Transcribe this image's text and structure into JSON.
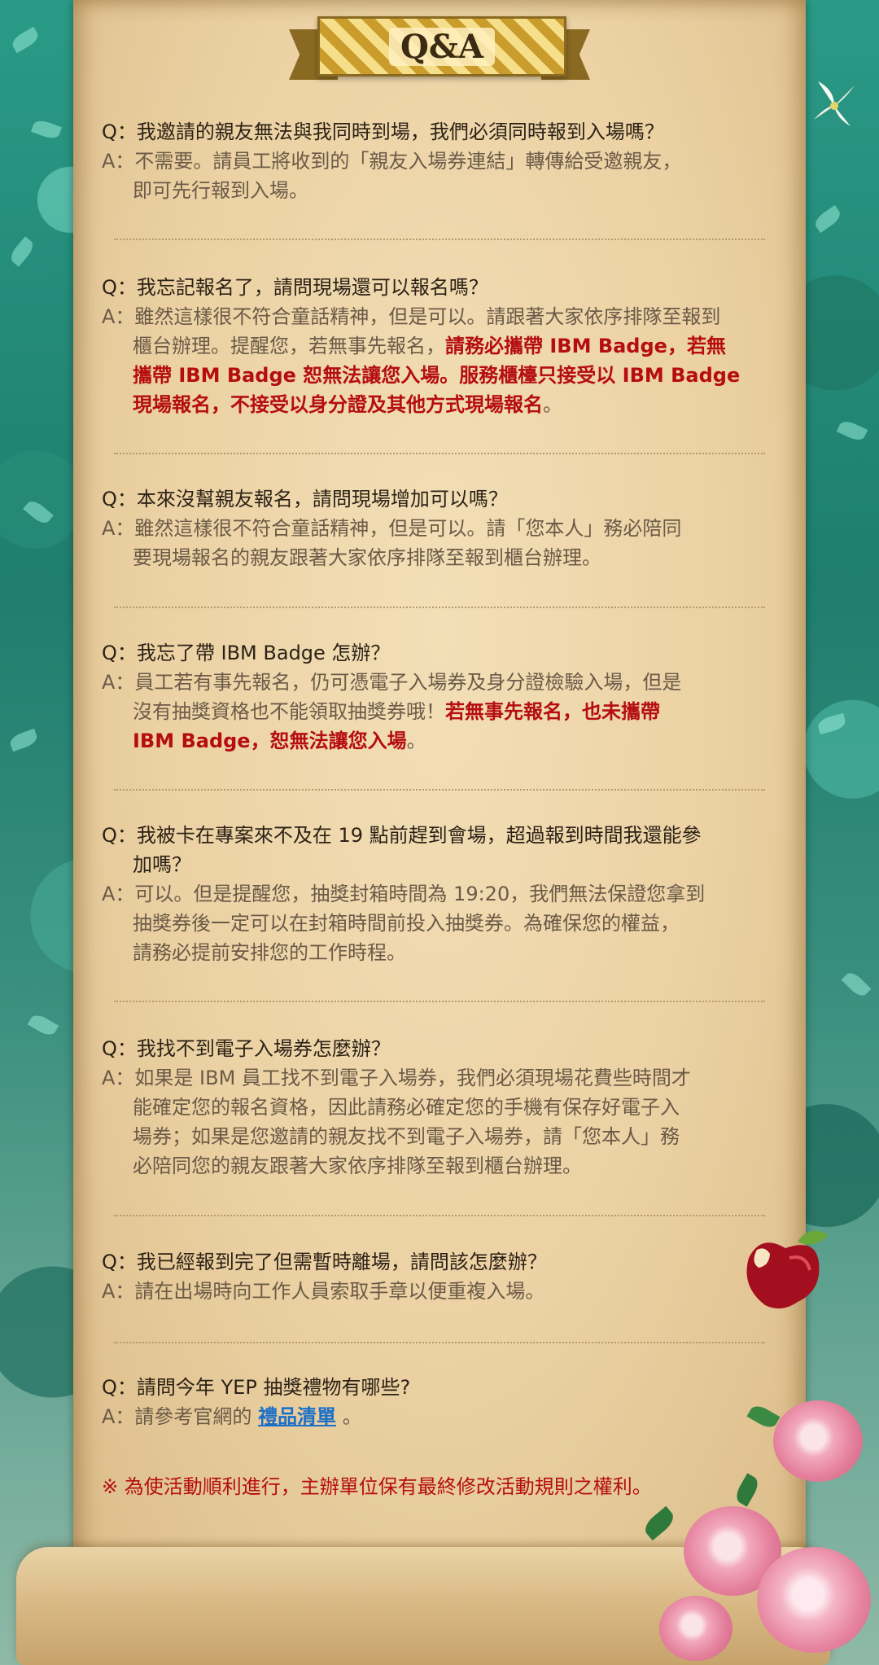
{
  "header": {
    "title": "Q&A"
  },
  "colors": {
    "highlight": "#b50d10",
    "link": "#1a6fc8",
    "question": "#2c2116",
    "answer": "#6b5a47"
  },
  "labels": {
    "q": "Q：",
    "a": "A："
  },
  "faq": [
    {
      "q": "我邀請的親友無法與我同時到場，我們必須同時報到入場嗎？",
      "a": [
        "不需要。請員工將收到的「親友入場券連結」轉傳給受邀親友，",
        "即可先行報到入場。"
      ]
    },
    {
      "q": "我忘記報名了，請問現場還可以報名嗎？",
      "a1": "雖然這樣很不符合童話精神，但是可以。請跟著大家依序排隊至報到",
      "a2": "櫃台辦理。提醒您，若無事先報名，",
      "h1": "請務必攜帶 IBM Badge，若無",
      "h2": "攜帶 IBM Badge 恕無法讓您入場。服務櫃檯只接受以 IBM Badge",
      "h3": "現場報名，不接受以身分證及其他方式現場報名",
      "end": "。"
    },
    {
      "q": "本來沒幫親友報名，請問現場增加可以嗎？",
      "a": [
        "雖然這樣很不符合童話精神，但是可以。請「您本人」務必陪同",
        "要現場報名的親友跟著大家依序排隊至報到櫃台辦理。"
      ]
    },
    {
      "q": "我忘了帶 IBM Badge 怎辦？",
      "a1": "員工若有事先報名，仍可憑電子入場券及身分證檢驗入場，但是",
      "a2": "沒有抽獎資格也不能領取抽獎券哦！",
      "h1": "若無事先報名，也未攜帶",
      "h2a": "IBM Badge，恕無法讓您入場",
      "end": "。"
    },
    {
      "q": [
        "我被卡在專案來不及在 19 點前趕到會場，超過報到時間我還能參",
        "加嗎？"
      ],
      "a": [
        "可以。但是提醒您，抽獎封箱時間為 19:20，我們無法保證您拿到",
        "抽獎券後一定可以在封箱時間前投入抽獎券。為確保您的權益，",
        "請務必提前安排您的工作時程。"
      ]
    },
    {
      "q": "我找不到電子入場券怎麼辦？",
      "a": [
        "如果是 IBM 員工找不到電子入場券，我們必須現場花費些時間才",
        "能確定您的報名資格，因此請務必確定您的手機有保存好電子入",
        "場券；如果是您邀請的親友找不到電子入場券，請「您本人」務",
        "必陪同您的親友跟著大家依序排隊至報到櫃台辦理。"
      ]
    },
    {
      "q": "我已經報到完了但需暫時離場，請問該怎麼辦？",
      "a": [
        "請在出場時向工作人員索取手章以便重複入場。"
      ]
    },
    {
      "q": "請問今年 YEP 抽獎禮物有哪些?",
      "a_prefix": "請參考官網的 ",
      "a_link": "禮品清單",
      "a_suffix": " 。"
    }
  ],
  "notice": "※ 為使活動順利進行，主辦單位保有最終修改活動規則之權利。"
}
